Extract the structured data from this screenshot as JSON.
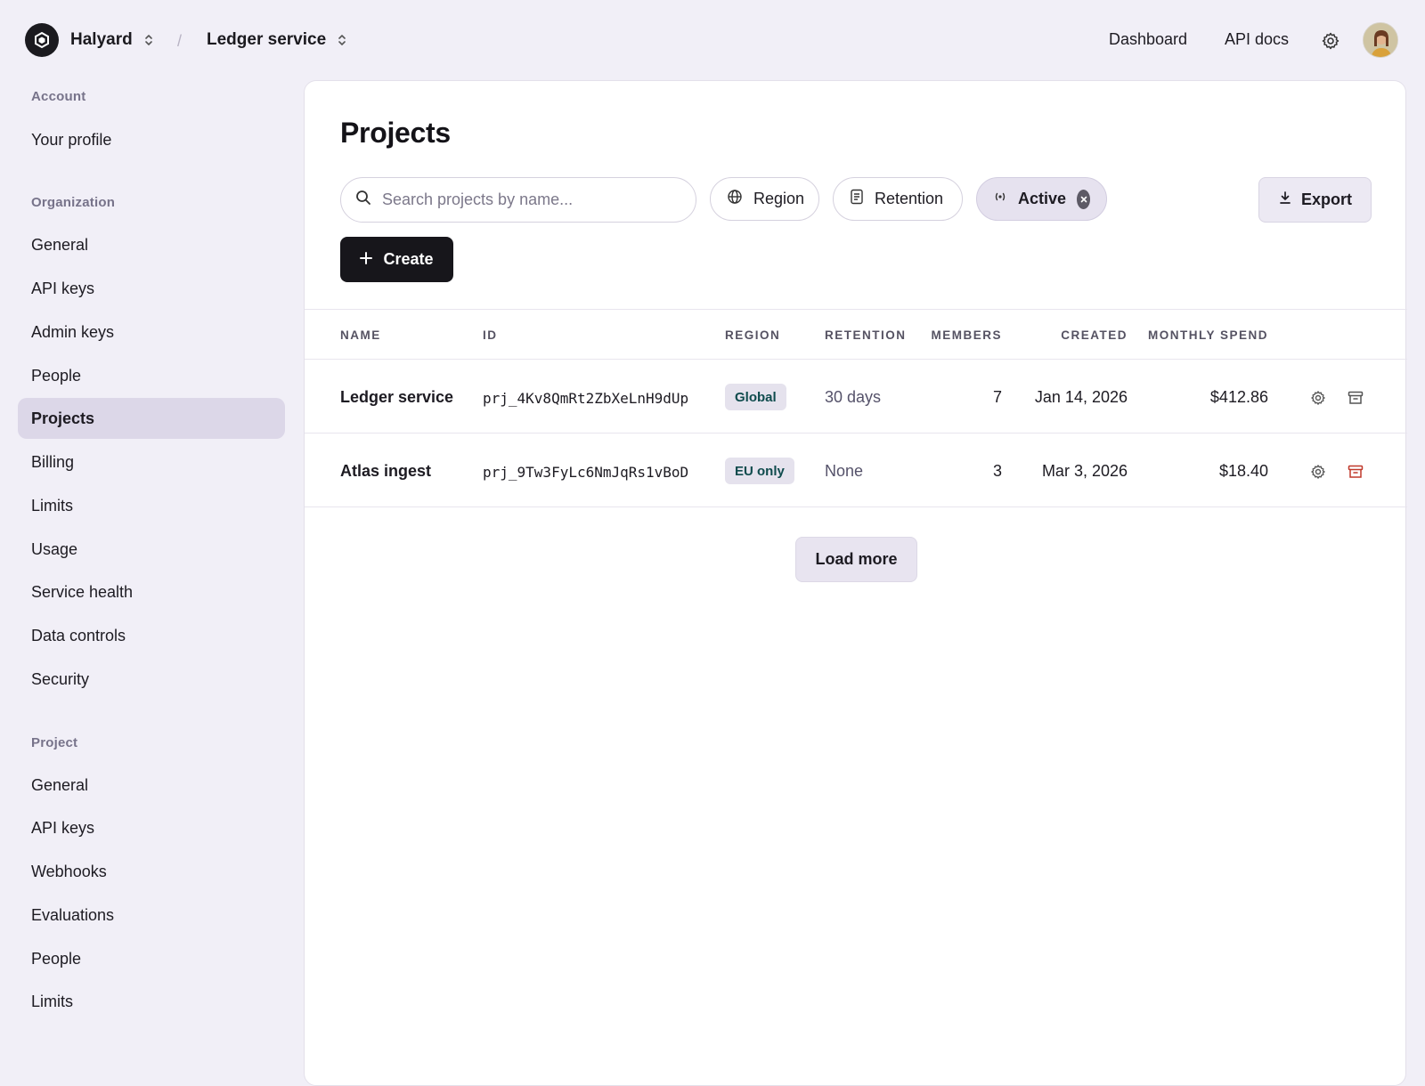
{
  "header": {
    "org_name": "Halyard",
    "separator": "/",
    "project_name": "Ledger service",
    "nav": {
      "dashboard": "Dashboard",
      "api_docs": "API docs"
    }
  },
  "sidebar": {
    "account": {
      "heading": "Account",
      "items": [
        "Your profile"
      ]
    },
    "organization": {
      "heading": "Organization",
      "items": [
        "General",
        "API keys",
        "Admin keys",
        "People",
        "Projects",
        "Billing",
        "Limits",
        "Usage",
        "Service health",
        "Data controls",
        "Security"
      ],
      "active": "Projects"
    },
    "project": {
      "heading": "Project",
      "items": [
        "General",
        "API keys",
        "Webhooks",
        "Evaluations",
        "People",
        "Limits"
      ]
    }
  },
  "main": {
    "title": "Projects",
    "search": {
      "placeholder": "Search projects by name...",
      "value": ""
    },
    "filters": {
      "region": "Region",
      "retention": "Retention",
      "active": "Active"
    },
    "export_label": "Export",
    "create_label": "Create",
    "table": {
      "columns": [
        "NAME",
        "ID",
        "REGION",
        "RETENTION",
        "MEMBERS",
        "CREATED",
        "MONTHLY SPEND"
      ],
      "rows": [
        {
          "name": "Ledger service",
          "id": "prj_4Kv8QmRt2ZbXeLnH9dUp",
          "region": "Global",
          "retention": "30 days",
          "members": "7",
          "created": "Jan 14, 2026",
          "spend": "$412.86"
        },
        {
          "name": "Atlas ingest",
          "id": "prj_9Tw3FyLc6NmJqRs1vBoD",
          "region": "EU only",
          "retention": "None",
          "members": "3",
          "created": "Mar 3, 2026",
          "spend": "$18.40"
        }
      ]
    },
    "load_more": "Load more"
  },
  "colors": {
    "background": "#f1eff7",
    "primary_button": "#17161b",
    "active_nav": "#dcd7e8",
    "archive_danger": "#c0392b"
  }
}
